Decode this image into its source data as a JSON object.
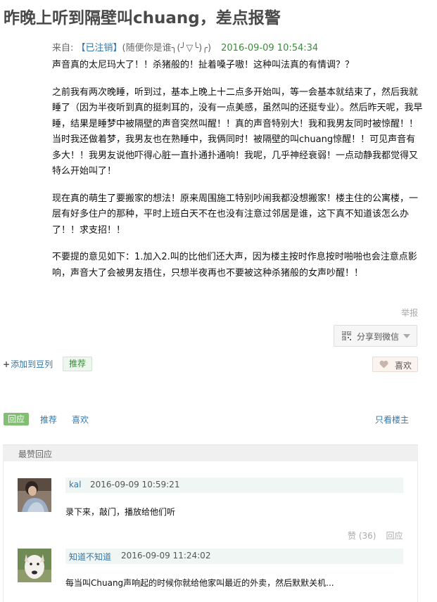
{
  "topic": {
    "title": "昨晚上听到隔壁叫chuang，差点报警",
    "from_label": "来自: ",
    "author": "【已注销】",
    "signature": "(随便你是谁╮(╯▽╰)╭)",
    "time": "2016-09-09 10:54:34"
  },
  "content": [
    "声音真的太尼玛大了！！杀猪般的！扯着嗓子嗷！这种叫法真的有情调？？",
    "之前我有两次晚睡，听到过，基本上晚上十二点多开始叫，等一会基本就结束了，然后我就睡了（因为半夜听到真的挺刺耳的，没有一点美感，虽然叫的还挺专业）。然后昨天呢，我早睡，结果是睡梦中被隔壁的声音突然叫醒！！真的声音特别大！我和我男友同时被惊醒！！当时我还做着梦，我男友也在熟睡中，我俩同时！被隔壁的叫chuang惊醒！！可见声音有多大！！我男友说他吓得心脏一直扑通扑通响！我呢，几乎神经衰弱！一点动静我都觉得又特么开始叫了！",
    "现在真的萌生了要搬家的想法！原来周围施工特别吵闹我都没想搬家！楼主住的公寓楼，一层有好多住户的那种，平时上班白天不在也没有注意过邻居是谁，这下真不知道该怎么办了！！求支招！！",
    "不要提的意见如下：1.加入2.叫的比他们还大声，因为楼主按时作息按时啪啪也会注意点影响，声音大了会被男友捂住，只想半夜再也不要被这种杀猪般的女声吵醒！！"
  ],
  "actions": {
    "report": "举报",
    "share": "分享到微信",
    "add_doulist": "添加到豆列",
    "add_plus": "+",
    "recommend": "推荐",
    "like": "喜欢"
  },
  "tabs": {
    "reply": "回应",
    "recommend": "推荐",
    "like": "喜欢",
    "only_op": "只看楼主"
  },
  "best": {
    "heading": "最赞回应",
    "comments": [
      {
        "user": "kal",
        "time": "2016-09-09 10:59:21",
        "text": "录下来，敲门，播放给他们听",
        "likes": "赞 (36)",
        "reply": "回应"
      },
      {
        "user": "知道不知道",
        "time": "2016-09-09 11:24:02",
        "text": "每当叫Chuang声响起的时候你就给他家叫最近的外卖，然后默默关机..."
      }
    ]
  },
  "icons": {
    "qr": "qr-code-icon",
    "caret": "chevron-down-icon",
    "heart": "heart-icon"
  },
  "colors": {
    "link": "#3377aa",
    "time_green": "#3d8a3d",
    "tab_active_bg": "#83bf73"
  }
}
